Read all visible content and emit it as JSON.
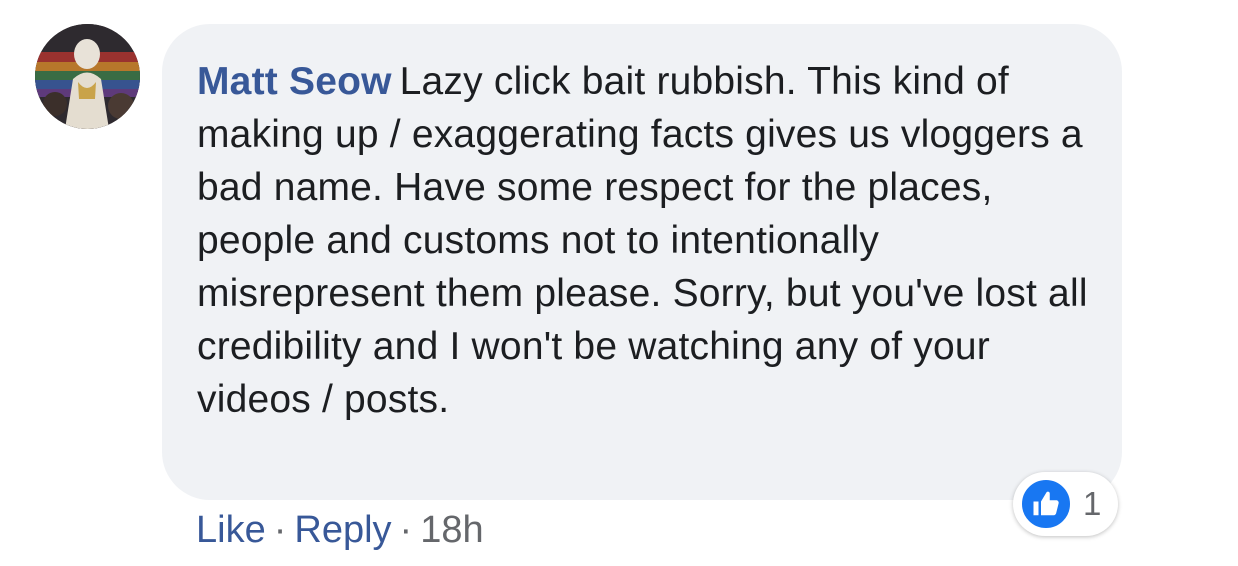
{
  "comment": {
    "author": "Matt Seow",
    "text": "Lazy click bait rubbish. This kind of making up / exaggerating facts gives us vloggers a bad name. Have some respect for the places, people and customs not to intentionally misrepresent them please. Sorry, but you've lost all credibility and I won't be watching any of your videos / posts."
  },
  "actions": {
    "like_label": "Like",
    "separator": "·",
    "reply_label": "Reply",
    "timestamp": "18h"
  },
  "reactions": {
    "icon": "thumbs-up-icon",
    "count": "1",
    "color": "#1877f2"
  },
  "colors": {
    "author": "#385898",
    "bubble": "#f0f2f5",
    "meta": "#65676b"
  }
}
